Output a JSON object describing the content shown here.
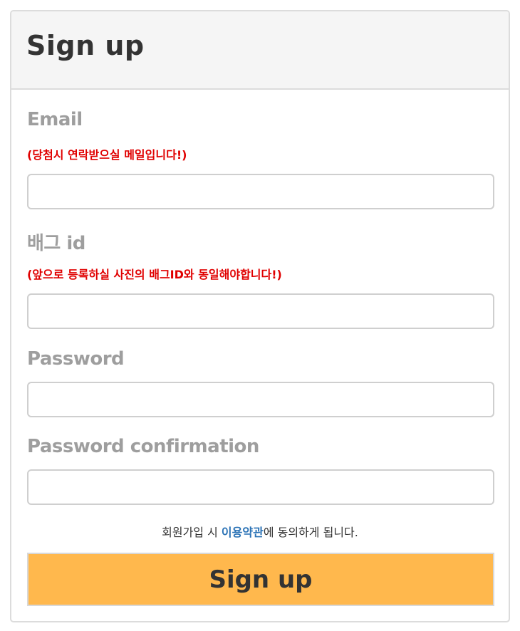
{
  "header": {
    "title": "Sign up"
  },
  "form": {
    "email": {
      "label": "Email",
      "hint": "(당첨시 연락받으실 메일입니다!)",
      "value": "",
      "placeholder": ""
    },
    "battleground_id": {
      "label": "배그 id",
      "hint": "(앞으로 등록하실 사진의 배그ID와 동일해야합니다!)",
      "value": "",
      "placeholder": ""
    },
    "password": {
      "label": "Password",
      "value": "",
      "placeholder": ""
    },
    "password_confirmation": {
      "label": "Password confirmation",
      "value": "",
      "placeholder": ""
    }
  },
  "agreement": {
    "prefix": "회원가입 시 ",
    "link": "이용약관",
    "suffix": "에 동의하게 됩니다."
  },
  "submit": {
    "label": "Sign up"
  },
  "colors": {
    "accent": "#ffb84d",
    "hint": "#e00000",
    "link": "#2b73b6",
    "label": "#9e9e9e"
  }
}
